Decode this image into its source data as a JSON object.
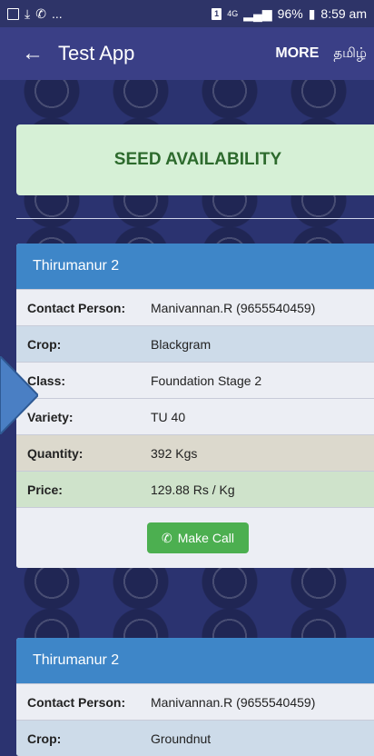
{
  "status": {
    "left_icons": [
      "gallery-icon",
      "download-icon",
      "phone-icon"
    ],
    "left_ellipsis": "...",
    "sim_label": "1",
    "network": "4G",
    "battery": "96%",
    "time": "8:59 am"
  },
  "appbar": {
    "back_glyph": "←",
    "title": "Test App",
    "more_label": "MORE",
    "language_label": "தமிழ்"
  },
  "banner": {
    "title": "SEED AVAILABILITY"
  },
  "cards": [
    {
      "header": "Thirumanur 2",
      "rows": [
        {
          "label": "Contact Person:",
          "value": "Manivannan.R (9655540459)"
        },
        {
          "label": "Crop:",
          "value": "Blackgram"
        },
        {
          "label": "Class:",
          "value": "Foundation Stage 2"
        },
        {
          "label": "Variety:",
          "value": "TU 40"
        },
        {
          "label": "Quantity:",
          "value": "392 Kgs"
        },
        {
          "label": "Price:",
          "value": "129.88 Rs / Kg"
        }
      ],
      "call_label": "Make Call"
    },
    {
      "header": "Thirumanur 2",
      "rows": [
        {
          "label": "Contact Person:",
          "value": "Manivannan.R (9655540459)"
        },
        {
          "label": "Crop:",
          "value": "Groundnut"
        }
      ]
    }
  ],
  "colors": {
    "appbar": "#3a3f86",
    "card_header": "#3e86c8",
    "banner": "#d6f0d6",
    "call_button": "#4caf50"
  }
}
